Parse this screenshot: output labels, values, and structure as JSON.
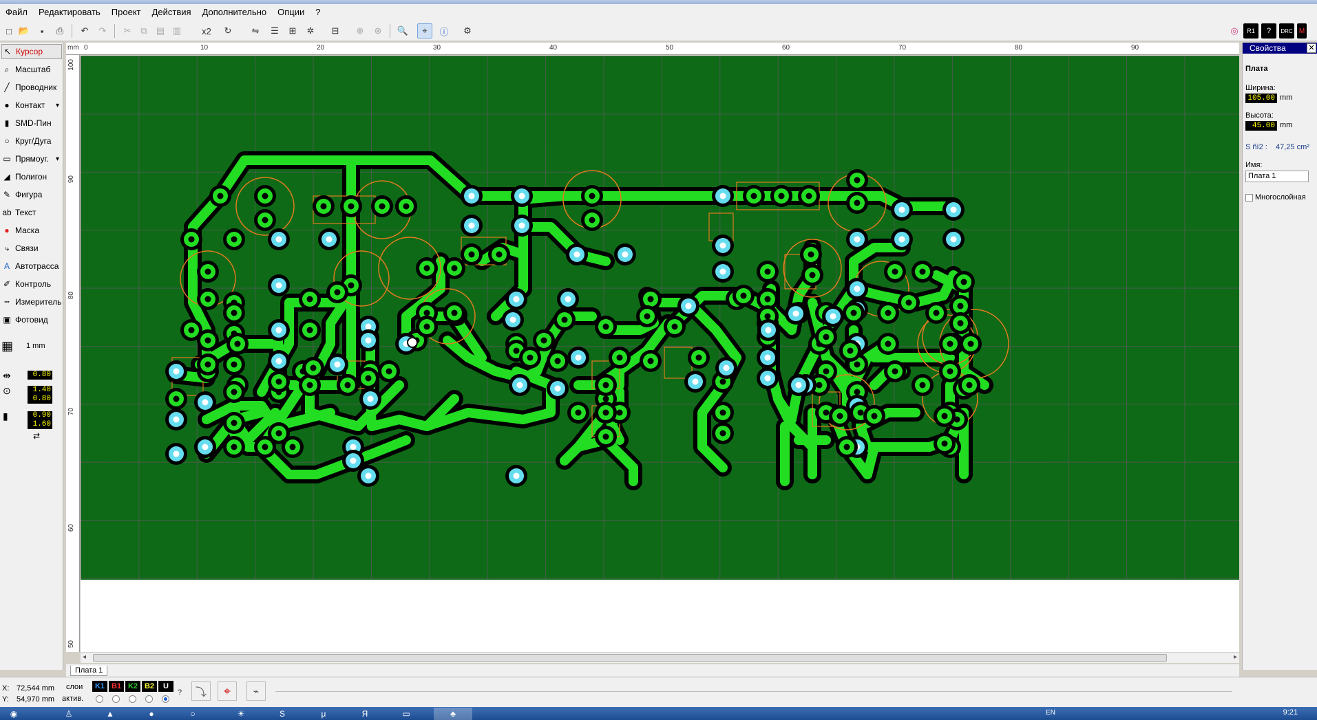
{
  "menu": [
    "Файл",
    "Редактировать",
    "Проект",
    "Действия",
    "Дополнительно",
    "Опции",
    "?"
  ],
  "toolbar": {
    "x2_label": "x2",
    "right_badges": [
      "R1",
      "?",
      "DRC",
      "M"
    ]
  },
  "tools": [
    {
      "label": "Курсор",
      "icon": "cursor-icon"
    },
    {
      "label": "Масштаб",
      "icon": "zoom-icon"
    },
    {
      "label": "Проводник",
      "icon": "track-icon"
    },
    {
      "label": "Контакт",
      "icon": "pad-icon"
    },
    {
      "label": "SMD-Пин",
      "icon": "smd-icon"
    },
    {
      "label": "Круг/Дуга",
      "icon": "circle-icon"
    },
    {
      "label": "Прямоуг.",
      "icon": "rect-icon"
    },
    {
      "label": "Полигон",
      "icon": "polygon-icon"
    },
    {
      "label": "Фигура",
      "icon": "shape-icon"
    },
    {
      "label": "Текст",
      "icon": "text-icon"
    },
    {
      "label": "Маска",
      "icon": "mask-icon"
    },
    {
      "label": "Связи",
      "icon": "connections-icon"
    },
    {
      "label": "Автотрасса",
      "icon": "autoroute-icon"
    },
    {
      "label": "Контроль",
      "icon": "test-icon"
    },
    {
      "label": "Измеритель",
      "icon": "measure-icon"
    },
    {
      "label": "Фотовид",
      "icon": "photoview-icon"
    }
  ],
  "grid": {
    "label": "1 mm"
  },
  "track_widths": {
    "track": "0.80",
    "pad_outer": "1.40",
    "pad_inner": "0.80",
    "smd_w": "0.90",
    "smd_h": "1.60"
  },
  "ruler": {
    "unit": "mm",
    "top_labels": [
      "0",
      "10",
      "20",
      "30",
      "40",
      "50",
      "60",
      "70",
      "80",
      "90"
    ],
    "left_labels": [
      "100",
      "90",
      "80",
      "70",
      "60",
      "50"
    ]
  },
  "properties": {
    "title": "Свойства",
    "section": "Плата",
    "width_label": "Ширина:",
    "width_value": "105.00",
    "height_label": "Высота:",
    "height_value": "45.00",
    "unit": "mm",
    "area_label": "S ñì2 :",
    "area_value": "47,25 cm²",
    "name_label": "Имя:",
    "name_value": "Плата 1",
    "multilayer_label": "Многослойная"
  },
  "tabs": [
    "Плата 1"
  ],
  "status": {
    "x_label": "X:",
    "x_value": "72,544 mm",
    "y_label": "Y:",
    "y_value": "54,970 mm",
    "layers_label": "слои",
    "active_label": "актив.",
    "layers": [
      {
        "name": "K1",
        "color": "#3399ff"
      },
      {
        "name": "B1",
        "color": "#ff3333"
      },
      {
        "name": "K2",
        "color": "#33cc33"
      },
      {
        "name": "B2",
        "color": "#ffff33"
      },
      {
        "name": "U",
        "color": "#ffffff"
      }
    ]
  },
  "taskbar": {
    "lang": "EN",
    "clock": "9:21"
  },
  "colors": {
    "board": "#0e6a16",
    "track": "#22dd22",
    "pad_ring": "#66ddee",
    "component_outline": "#e07a20"
  }
}
